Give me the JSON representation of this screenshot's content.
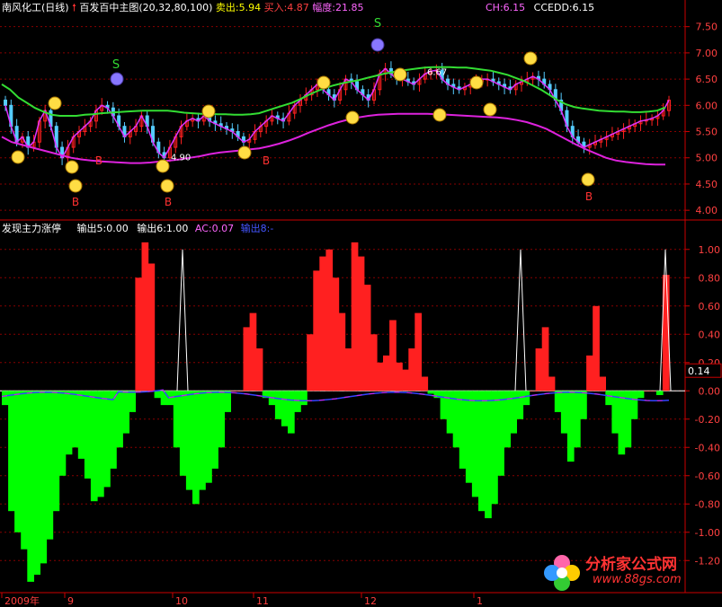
{
  "header": {
    "stock": "南风化工(日线)",
    "indicator": "百发百中主图(20,32,80,100)",
    "sell_label": "卖出:5.94",
    "buy_label": "买入:4.87",
    "range_label": "幅度:21.85",
    "ch_label": "CH:6.15",
    "ccedd_label": "CCEDD:6.15"
  },
  "sub_header": {
    "title": "发现主力涨停",
    "out5": "输出5:0.00",
    "out6": "输出6:1.00",
    "ac": "AC:0.07",
    "out8": "输出8:-"
  },
  "colors": {
    "up": "#ff2020",
    "down": "#00ff00",
    "ma_green": "#33dd33",
    "ma_magenta": "#dd22dd",
    "line_white": "#ffffff",
    "ac_blue": "#3344ff",
    "grid": "#880000"
  },
  "annotations": {
    "high_label": "6.67",
    "low_label": "4.90",
    "sell_marker": "S",
    "buy_marker": "B",
    "current_value": "0.14"
  },
  "x_axis": {
    "labels": [
      "2009年",
      "9",
      "10",
      "11",
      "12",
      "1"
    ]
  },
  "watermark": {
    "title": "分析家公式网",
    "url": "www.88gs.com"
  },
  "chart_data": [
    {
      "type": "line",
      "title": "百发百中主图(20,32,80,100)",
      "ylim": [
        3.9,
        7.7
      ],
      "y_ticks": [
        "7.50",
        "7.00",
        "6.50",
        "6.00",
        "5.50",
        "5.00",
        "4.50",
        "4.00"
      ],
      "x": [
        1,
        2,
        3,
        4,
        5,
        6,
        7,
        8,
        9,
        10,
        11,
        12,
        13,
        14,
        15,
        16,
        17,
        18,
        19,
        20,
        21,
        22,
        23,
        24,
        25,
        26,
        27,
        28,
        29,
        30,
        31,
        32,
        33,
        34,
        35,
        36,
        37,
        38,
        39,
        40,
        41,
        42,
        43,
        44,
        45,
        46,
        47,
        48,
        49,
        50,
        51,
        52,
        53,
        54,
        55,
        56,
        57,
        58,
        59,
        60,
        61,
        62,
        63,
        64,
        65,
        66,
        67,
        68,
        69,
        70,
        71,
        72,
        73,
        74,
        75,
        76,
        77,
        78,
        79,
        80,
        81,
        82,
        83,
        84,
        85,
        86,
        87,
        88,
        89,
        90,
        91,
        92,
        93,
        94,
        95,
        96,
        97,
        98,
        99,
        100,
        101,
        102,
        103,
        104,
        105,
        106,
        107,
        108,
        109,
        110,
        111,
        112,
        113,
        114,
        115,
        116,
        117,
        118,
        119,
        120,
        121,
        122,
        123,
        124,
        125,
        126,
        127,
        128,
        129,
        130,
        131,
        132,
        133,
        134,
        135,
        136,
        137,
        138,
        139,
        140,
        141,
        142,
        143,
        144,
        145,
        146,
        147,
        148,
        149,
        150,
        151,
        152,
        153,
        154,
        155,
        156,
        157,
        158,
        159,
        160,
        161,
        162,
        163,
        164,
        165,
        166,
        167,
        168,
        169,
        170,
        171,
        172,
        173,
        174,
        175,
        176,
        177,
        178,
        179,
        180,
        181,
        182,
        183,
        184,
        185
      ],
      "series": [
        {
          "values": [
            6.0,
            5.6,
            5.3,
            5.4,
            5.2,
            5.3,
            5.7,
            5.9,
            5.6,
            5.2,
            5.0,
            5.2,
            5.4,
            5.5,
            5.6,
            5.7,
            5.9,
            6.0,
            5.95,
            5.8,
            5.6,
            5.4,
            5.5,
            5.6,
            5.8,
            5.6,
            5.3,
            5.1,
            5.0,
            5.2,
            5.4,
            5.6,
            5.7,
            5.75,
            5.7,
            5.8,
            5.7,
            5.65,
            5.6,
            5.55,
            5.5,
            5.4,
            5.3,
            5.35,
            5.5,
            5.6,
            5.7,
            5.8,
            5.75,
            5.7,
            5.85,
            6.0,
            6.1,
            6.2,
            6.3,
            6.4,
            6.3,
            6.2,
            6.1,
            6.3,
            6.5,
            6.45,
            6.3,
            6.2,
            6.1,
            6.3,
            6.6,
            6.7,
            6.6,
            6.5,
            6.5,
            6.45,
            6.4,
            6.5,
            6.6,
            6.65,
            6.67,
            6.5,
            6.4,
            6.35,
            6.3,
            6.35,
            6.4,
            6.45,
            6.5,
            6.5,
            6.45,
            6.4,
            6.35,
            6.3,
            6.4,
            6.45,
            6.5,
            6.55,
            6.5,
            6.4,
            6.3,
            6.1,
            5.9,
            5.6,
            5.4,
            5.3,
            5.2,
            5.25,
            5.3,
            5.35,
            5.4,
            5.45,
            5.5,
            5.55,
            5.6,
            5.65,
            5.7,
            5.72,
            5.75,
            5.8,
            5.9,
            6.1
          ]
        },
        {
          "values": [
            6.4,
            6.3,
            6.15,
            6.05,
            5.95,
            5.88,
            5.82,
            5.8,
            5.8,
            5.8,
            5.82,
            5.83,
            5.85,
            5.86,
            5.87,
            5.88,
            5.89,
            5.9,
            5.9,
            5.9,
            5.9,
            5.88,
            5.86,
            5.85,
            5.84,
            5.84,
            5.83,
            5.83,
            5.82,
            5.82,
            5.83,
            5.85,
            5.9,
            5.95,
            6.0,
            6.05,
            6.12,
            6.2,
            6.27,
            6.33,
            6.38,
            6.42,
            6.45,
            6.48,
            6.52,
            6.56,
            6.6,
            6.63,
            6.66,
            6.68,
            6.7,
            6.72,
            6.73,
            6.73,
            6.73,
            6.72,
            6.72,
            6.7,
            6.68,
            6.66,
            6.62,
            6.58,
            6.52,
            6.46,
            6.38,
            6.3,
            6.2,
            6.1,
            6.02,
            5.97,
            5.94,
            5.92,
            5.9,
            5.89,
            5.88,
            5.88,
            5.87,
            5.87,
            5.88,
            5.9,
            5.96
          ]
        },
        {
          "values": [
            5.4,
            5.3,
            5.25,
            5.2,
            5.15,
            5.1,
            5.05,
            5.0,
            4.97,
            4.95,
            4.93,
            4.92,
            4.91,
            4.9,
            4.9,
            4.91,
            4.93,
            4.95,
            4.97,
            5.0,
            5.03,
            5.07,
            5.1,
            5.12,
            5.14,
            5.16,
            5.18,
            5.22,
            5.27,
            5.33,
            5.4,
            5.48,
            5.55,
            5.62,
            5.68,
            5.73,
            5.77,
            5.8,
            5.82,
            5.83,
            5.84,
            5.84,
            5.84,
            5.84,
            5.83,
            5.82,
            5.81,
            5.8,
            5.79,
            5.78,
            5.77,
            5.75,
            5.72,
            5.68,
            5.62,
            5.55,
            5.45,
            5.35,
            5.25,
            5.16,
            5.08,
            5.0,
            4.95,
            4.92,
            4.9,
            4.88,
            4.87,
            4.87
          ]
        }
      ]
    },
    {
      "type": "bar",
      "title": "发现主力涨停",
      "ylim": [
        -1.3,
        1.1
      ],
      "y_ticks": [
        "1.00",
        "0.80",
        "0.60",
        "0.40",
        "0.20",
        "0.00",
        "-0.20",
        "-0.40",
        "-0.60",
        "-0.80",
        "-1.00",
        "-1.20"
      ],
      "values": [
        -0.1,
        -0.85,
        -1.0,
        -1.12,
        -1.35,
        -1.3,
        -1.22,
        -1.05,
        -0.85,
        -0.6,
        -0.45,
        -0.4,
        -0.48,
        -0.62,
        -0.78,
        -0.75,
        -0.68,
        -0.55,
        -0.4,
        -0.3,
        -0.15,
        0.8,
        1.05,
        0.9,
        -0.05,
        -0.1,
        -0.1,
        -0.4,
        -0.6,
        -0.7,
        -0.8,
        -0.7,
        -0.65,
        -0.55,
        -0.4,
        -0.15,
        0.0,
        0.0,
        0.45,
        0.55,
        0.3,
        -0.05,
        -0.1,
        -0.2,
        -0.25,
        -0.3,
        -0.15,
        -0.1,
        0.4,
        0.85,
        0.95,
        1.0,
        0.8,
        0.55,
        0.3,
        1.05,
        0.95,
        0.75,
        0.4,
        0.2,
        0.25,
        0.5,
        0.2,
        0.15,
        0.3,
        0.55,
        0.1,
        -0.02,
        -0.05,
        -0.2,
        -0.3,
        -0.4,
        -0.55,
        -0.65,
        -0.75,
        -0.85,
        -0.9,
        -0.8,
        -0.6,
        -0.4,
        -0.3,
        -0.2,
        -0.1,
        0.0,
        0.3,
        0.45,
        0.1,
        -0.15,
        -0.3,
        -0.5,
        -0.4,
        -0.2,
        0.25,
        0.6,
        0.1,
        -0.1,
        -0.3,
        -0.45,
        -0.4,
        -0.2,
        -0.05,
        0.0,
        0.0,
        -0.03,
        0.82
      ]
    }
  ]
}
